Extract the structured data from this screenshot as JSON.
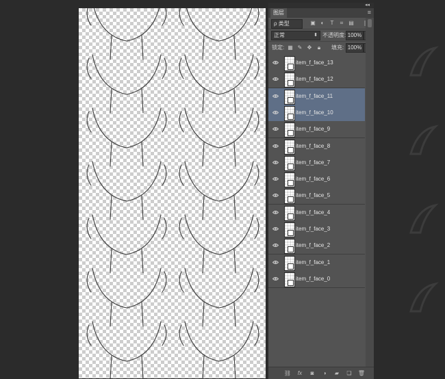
{
  "panel": {
    "tab_label": "图层",
    "collapse_label": "◂◂",
    "close_label": "✕",
    "menu_icon": "≡",
    "filter_label": "ρ 类型",
    "filter_icons": [
      "image-filter-icon",
      "adjustment-filter-icon",
      "type-filter-icon",
      "shape-filter-icon",
      "smart-object-filter-icon"
    ],
    "blend_mode": "正常",
    "opacity_label": "不透明度:",
    "opacity_value": "100%",
    "lock_label": "锁定:",
    "fill_label": "填充:",
    "fill_value": "100%"
  },
  "layers": [
    {
      "name": "item_f_face_13",
      "selected": false
    },
    {
      "name": "item_f_face_12",
      "selected": false
    },
    {
      "name": "item_f_face_11",
      "selected": true
    },
    {
      "name": "item_f_face_10",
      "selected": true
    },
    {
      "name": "item_f_face_9",
      "selected": false
    },
    {
      "name": "item_f_face_8",
      "selected": false
    },
    {
      "name": "item_f_face_7",
      "selected": false
    },
    {
      "name": "item_f_face_6",
      "selected": false
    },
    {
      "name": "item_f_face_5",
      "selected": false
    },
    {
      "name": "item_f_face_4",
      "selected": false
    },
    {
      "name": "item_f_face_3",
      "selected": false
    },
    {
      "name": "item_f_face_2",
      "selected": false
    },
    {
      "name": "item_f_face_1",
      "selected": false
    },
    {
      "name": "item_f_face_0",
      "selected": false
    }
  ],
  "bottom_icons": [
    "link-layers-icon",
    "fx-icon",
    "mask-icon",
    "adjustment-layer-icon",
    "new-group-icon",
    "new-layer-icon",
    "trash-icon"
  ],
  "colors": {
    "selected_layer": "#5f6f87",
    "panel_bg": "#535353",
    "workspace_bg": "#2b2b2b"
  }
}
